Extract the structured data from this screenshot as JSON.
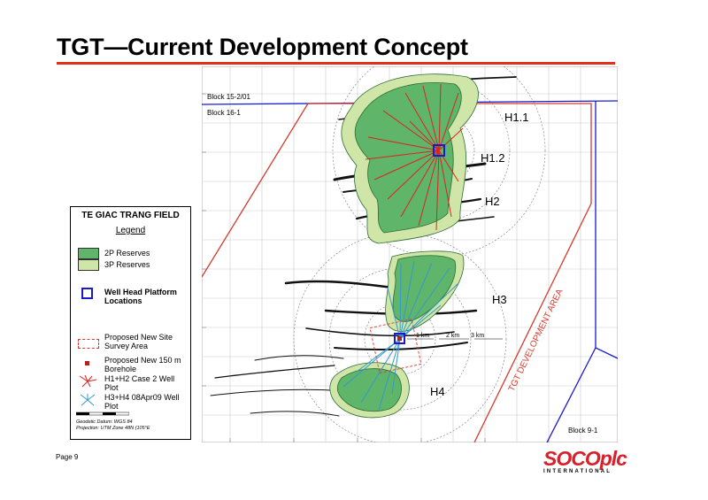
{
  "page": {
    "title": "TGT—Current Development Concept",
    "footer": "Page 9",
    "logo_main": "SOCOplc",
    "logo_sub": "INTERNATIONAL"
  },
  "legend": {
    "title": "TE GIAC TRANG FIELD",
    "heading": "Legend",
    "items": [
      {
        "label": "2P Reserves",
        "color": "#5fb56a"
      },
      {
        "label": "3P Reserves",
        "color": "#cfe6a8"
      },
      {
        "label": "Well Head Platform Locations",
        "color": "#1a1acc"
      },
      {
        "label": "Proposed New Site Survey Area",
        "color": "#d33b2c"
      },
      {
        "label": "Proposed New 150 m Borehole",
        "color": "#b22222"
      },
      {
        "label": "H1+H2 Case 2 Well Plot",
        "color": "#dd2222"
      },
      {
        "label": "H3+H4 08Apr09 Well Plot",
        "color": "#3399cc"
      }
    ],
    "datum": "Geodetic Datum: WGS 84",
    "projection": "Projection: UTM Zone 48N (105°E"
  },
  "map": {
    "blocks": [
      "Block 15-2/01",
      "Block 16-1",
      "Block 9-1"
    ],
    "areas": [
      "H1.1",
      "H1.2",
      "H2",
      "H3",
      "H4"
    ],
    "development_area": "TGT DEVELOPMENT AREA",
    "rings": [
      "1 km",
      "2 km",
      "3 km"
    ],
    "colors": {
      "block_line": "#1a1acc",
      "dev_line": "#d33b2c",
      "reserve_2p": "#5fb56a",
      "reserve_3p": "#cfe6a8"
    }
  }
}
